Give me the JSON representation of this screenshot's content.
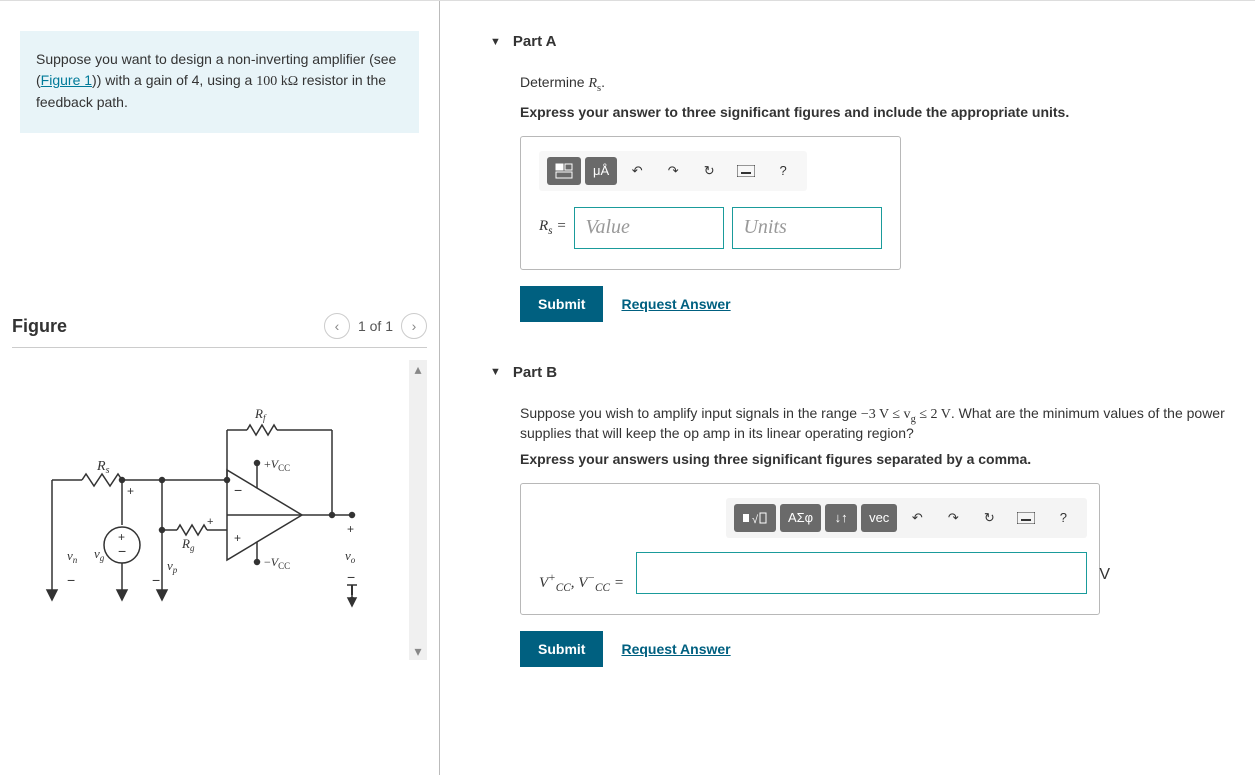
{
  "problem": {
    "text_before": "Suppose you want to design a non-inverting amplifier (see (",
    "figure_link": "Figure 1",
    "text_mid": ")) with a gain of 4, using a ",
    "resistor_val": "100 kΩ",
    "text_after": " resistor in the feedback path."
  },
  "figure": {
    "title": "Figure",
    "page_label": "1 of 1"
  },
  "partA": {
    "title": "Part A",
    "prompt_prefix": "Determine ",
    "prompt_var": "R",
    "prompt_var_sub": "s",
    "prompt_suffix": ".",
    "instruction": "Express your answer to three significant figures and include the appropriate units.",
    "label_var": "R",
    "label_sub": "s",
    "label_eq": " = ",
    "value_placeholder": "Value",
    "units_placeholder": "Units",
    "toolbar": {
      "units_btn": "μÅ"
    },
    "submit": "Submit",
    "request": "Request Answer"
  },
  "partB": {
    "title": "Part B",
    "prompt_before": "Suppose you wish to amplify input signals in the range ",
    "range": "−3 V ≤ v",
    "range_sub": "g",
    "range_after": " ≤ 2 V",
    "prompt_after": ". What are the minimum values of the power supplies that will keep the op amp in its linear operating region?",
    "instruction": "Express your answers using three significant figures separated by a comma.",
    "toolbar": {
      "greek": "ΑΣφ",
      "vec": "vec"
    },
    "unit": "V",
    "label_html": "V⁺_CC, V⁻_CC = ",
    "submit": "Submit",
    "request": "Request Answer"
  }
}
